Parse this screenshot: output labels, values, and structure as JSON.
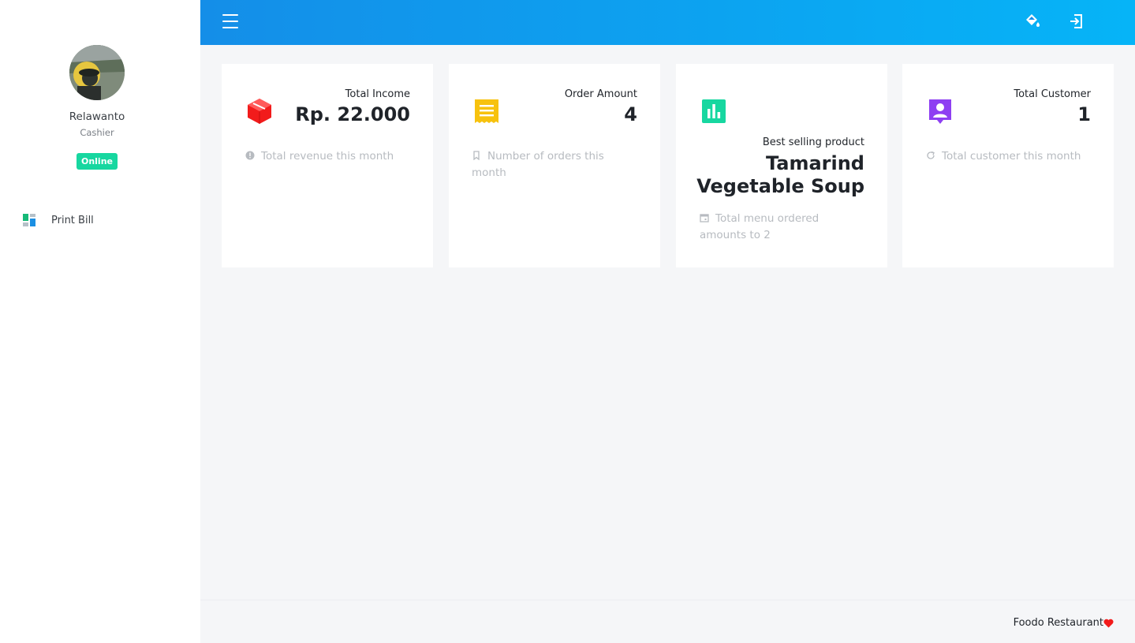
{
  "sidebar": {
    "user": {
      "name": "Relawanto",
      "role": "Cashier",
      "status": "Online"
    },
    "items": [
      {
        "label": "Print Bill",
        "icon": "dashboard-grid-icon"
      }
    ]
  },
  "header": {
    "icons": [
      "menu-icon",
      "paint-bucket-icon",
      "logout-icon"
    ]
  },
  "cards": [
    {
      "label": "Total Income",
      "value": "Rp.  22.000",
      "footer": "Total revenue this month",
      "icon": "cube-icon",
      "color": "#f21b1b",
      "footer_icon": "info-circle-icon"
    },
    {
      "label": "Order Amount",
      "value": "4",
      "footer": "Number of orders this month",
      "icon": "receipt-icon",
      "color": "#f7c20e",
      "footer_icon": "bookmark-icon"
    },
    {
      "label": "Best selling product",
      "value": "Tamarind Vegetable Soup",
      "footer": "Total menu ordered amounts to  2",
      "icon": "bar-chart-icon",
      "color": "#17d7a0",
      "footer_icon": "calendar-icon"
    },
    {
      "label": "Total Customer",
      "value": "1",
      "footer": "Total customer this month",
      "icon": "person-pin-icon",
      "color": "#8e3ff2",
      "footer_icon": "refresh-icon"
    }
  ],
  "footer": {
    "text": "Foodo Restaurant"
  },
  "colors": {
    "header_start": "#148ee8",
    "header_end": "#06b4f7",
    "badge": "#17d7a0",
    "heart": "#f21b1b"
  }
}
